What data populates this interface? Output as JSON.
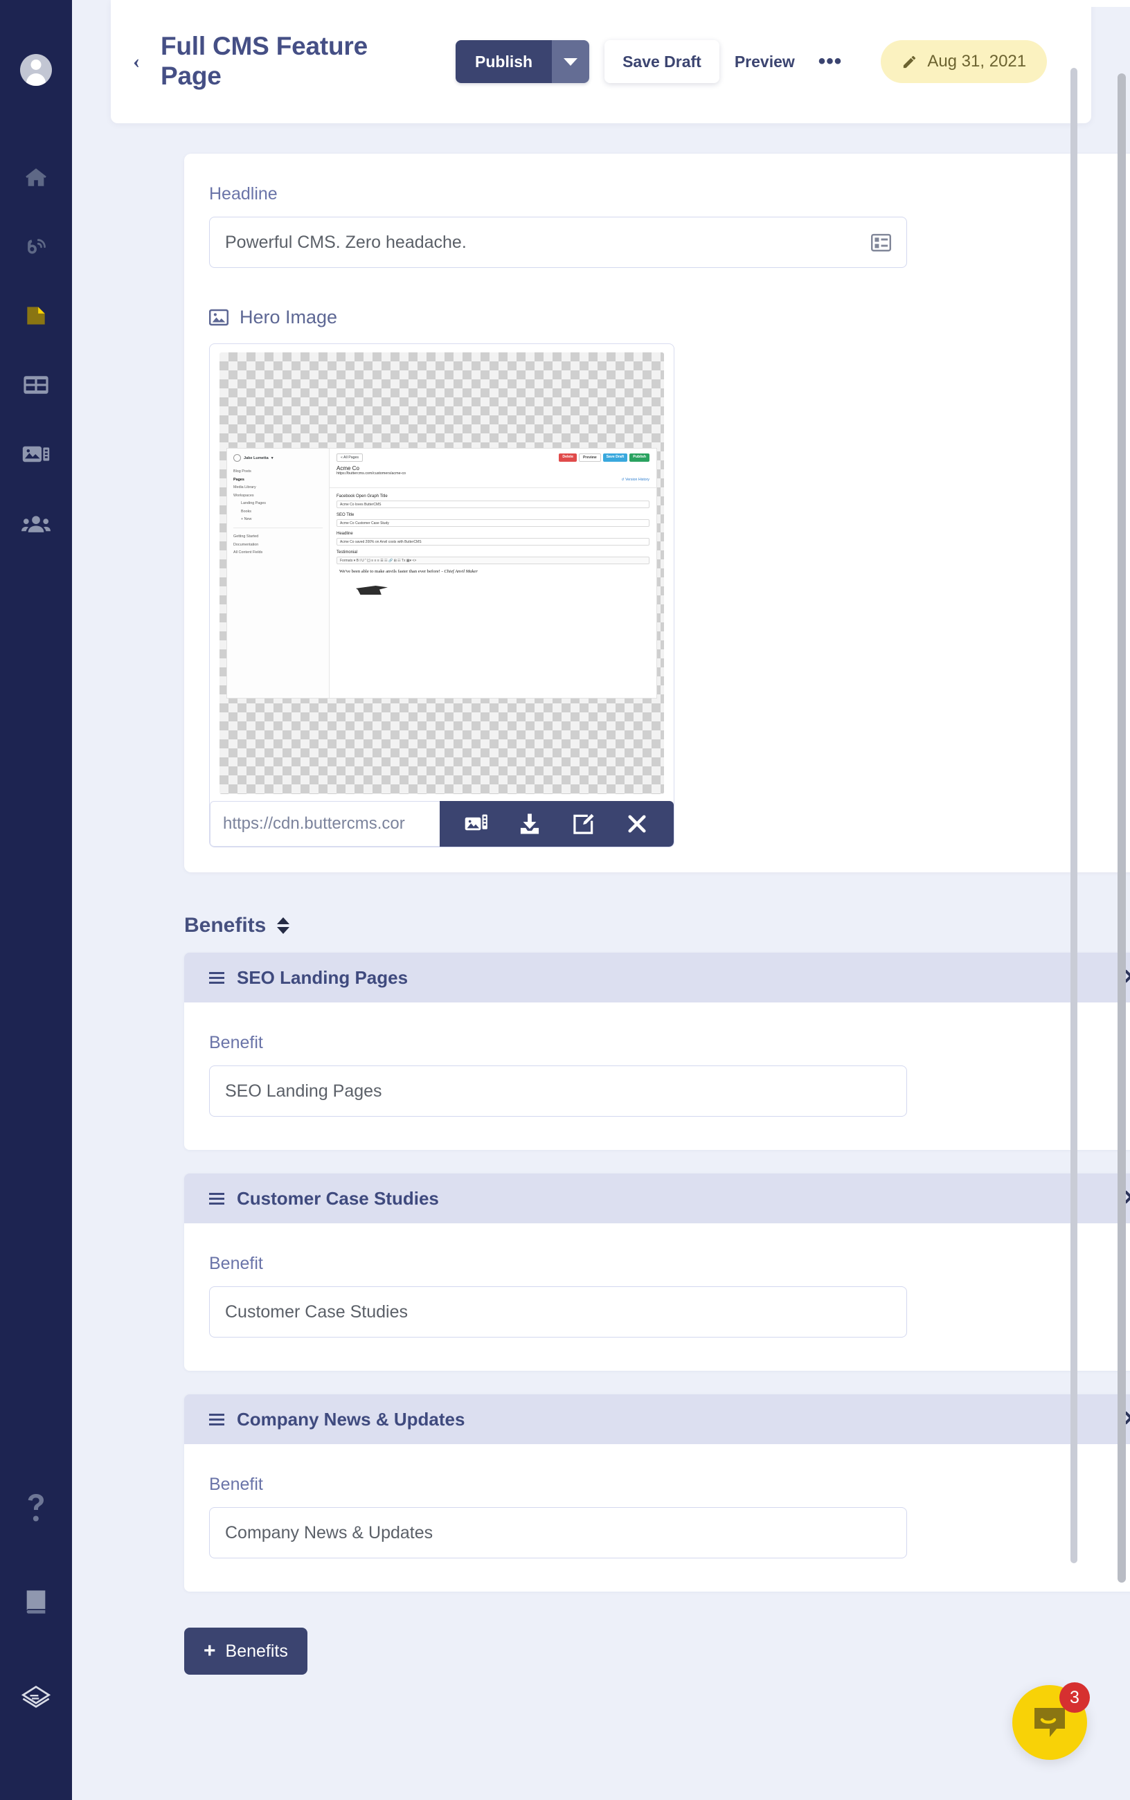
{
  "sidebar": {
    "avatar": "user-avatar",
    "top_items": [
      {
        "icon": "home-icon",
        "name": "home"
      },
      {
        "icon": "blog-rss-icon",
        "name": "blog-posts"
      },
      {
        "icon": "pages-document-icon",
        "name": "pages",
        "active": true
      },
      {
        "icon": "collections-table-icon",
        "name": "collections"
      },
      {
        "icon": "media-library-icon",
        "name": "media-library"
      },
      {
        "icon": "team-users-icon",
        "name": "team"
      }
    ],
    "bottom_items": [
      {
        "icon": "question-mark-icon",
        "name": "help"
      },
      {
        "icon": "book-icon",
        "name": "documentation"
      },
      {
        "icon": "layers-stack-icon",
        "name": "api-explorer"
      }
    ]
  },
  "header": {
    "back_label": "‹",
    "title": "Full CMS Feature Page",
    "publish_label": "Publish",
    "save_draft_label": "Save Draft",
    "preview_label": "Preview",
    "more_label": "•••",
    "date_badge": "Aug 31, 2021"
  },
  "fields": {
    "headline": {
      "label": "Headline",
      "value": "Powerful CMS. Zero headache."
    },
    "hero_image": {
      "label": "Hero Image",
      "url_value": "https://cdn.buttercms.cor",
      "actions": [
        {
          "name": "choose-image-icon",
          "label": "choose image"
        },
        {
          "name": "download-icon",
          "label": "download"
        },
        {
          "name": "edit-icon",
          "label": "edit"
        },
        {
          "name": "remove-icon",
          "label": "remove"
        }
      ]
    }
  },
  "hero_preview": {
    "user": "Jake Lumetta",
    "nav": [
      "Blog Posts",
      "Pages",
      "Media Library",
      "Workspaces"
    ],
    "sub_nav": [
      "Landing Pages",
      "Books",
      "+ New"
    ],
    "footer_nav": [
      "Getting Started",
      "Documentation",
      "All Content Fields"
    ],
    "all_pages": "« All Pages",
    "buttons": [
      "Delete",
      "Preview",
      "Save Draft",
      "Publish"
    ],
    "version_history": "↺ Version History",
    "page_name": "Acme Co",
    "page_url": "https://buttercms.com/customers/acme-co",
    "og_title_label": "Facebook Open Graph Title",
    "og_title_value": "Acme Co loves ButterCMS",
    "seo_title_label": "SEO Title",
    "seo_title_value": "Acme Co Customer Case Study",
    "headline_label": "Headline",
    "headline_value": "Acme Co saved 200% on Anvil costs with ButterCMS",
    "testimonial_label": "Testimonial",
    "toolbar_label": "Formats ▾  B  I  U  “  {;}  ≡ ≡ ≡  ☰ ☷  🔗  ⊞  ☷  Tx  ▦▾  <>",
    "quote": "We've been able to make anvils faster than ever before! - ",
    "quote_italic": "Chief Anvil Maker"
  },
  "benefits_section": {
    "title": "Benefits",
    "item_field_label": "Benefit",
    "items": [
      {
        "title": "SEO Landing Pages",
        "value": "SEO Landing Pages"
      },
      {
        "title": "Customer Case Studies",
        "value": "Customer Case Studies"
      },
      {
        "title": "Company News & Updates",
        "value": "Company News & Updates"
      }
    ],
    "add_label": "Benefits",
    "add_plus": "+"
  },
  "chat": {
    "badge_count": "3"
  },
  "colors": {
    "sidebar_bg": "#1d2451",
    "page_bg": "#edf0f9",
    "primary": "#3b4470",
    "accent_yellow": "#f8d207",
    "date_badge_bg": "#fbf2c0",
    "benefit_header_bg": "#dcdff0",
    "badge_red": "#d63030"
  }
}
